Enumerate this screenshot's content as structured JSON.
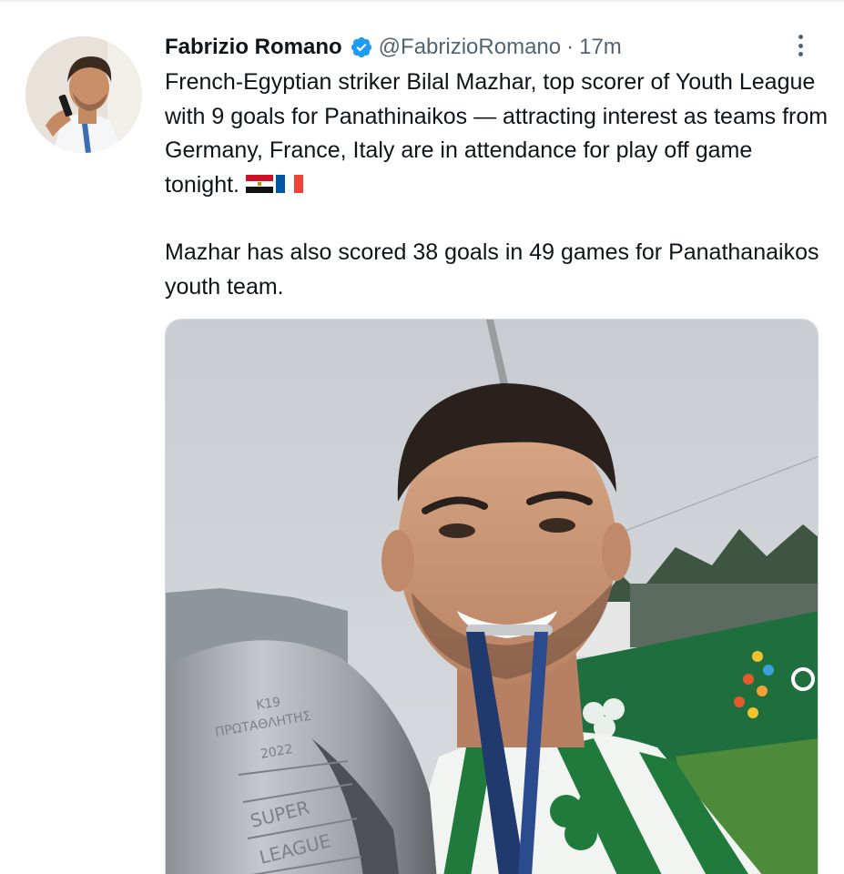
{
  "tweet": {
    "author": {
      "name": "Fabrizio Romano",
      "handle": "@FabrizioRomano",
      "verified": true
    },
    "separator": "·",
    "time": "17m",
    "paragraphs": [
      "French-Egyptian striker Bilal Mazhar, top scorer of Youth League with 9 goals for Panathinaikos — attracting interest as teams from Germany, France, Italy are in attendance for play off game tonight.",
      "Mazhar has also scored 38 goals in 49 games for Panathanaikos youth team."
    ],
    "emoji_flags": [
      "egypt-flag",
      "france-flag"
    ],
    "photo": {
      "trophy_text": [
        "K19",
        "ΠΡΩΤΑΘΛΗΤΗΣ",
        "2022",
        "SUPER",
        "LEAGUE"
      ]
    }
  },
  "colors": {
    "text_primary": "#0f1419",
    "text_secondary": "#536471",
    "verified_blue": "#1d9bf0",
    "divider": "#eff3f4",
    "panathinaikos_green": "#1f7a3c"
  },
  "icons": {
    "verified": "verified-badge-icon",
    "more": "more-options-icon"
  }
}
